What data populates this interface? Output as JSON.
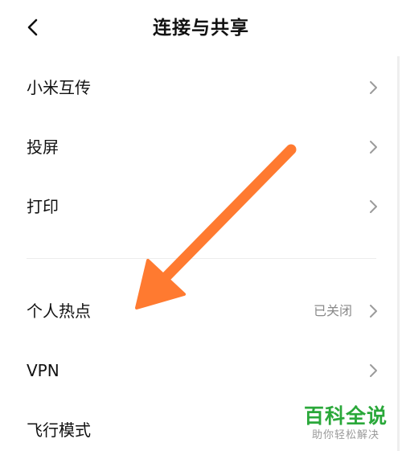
{
  "header": {
    "title": "连接与共享",
    "back_icon": "chevron-left-icon"
  },
  "group1": [
    {
      "label": "小米互传",
      "chevron_icon": "chevron-right-icon"
    },
    {
      "label": "投屏",
      "chevron_icon": "chevron-right-icon"
    },
    {
      "label": "打印",
      "chevron_icon": "chevron-right-icon"
    }
  ],
  "group2": [
    {
      "label": "个人热点",
      "status": "已关闭",
      "chevron_icon": "chevron-right-icon"
    },
    {
      "label": "VPN",
      "chevron_icon": "chevron-right-icon"
    },
    {
      "label": "飞行模式"
    }
  ],
  "watermark": {
    "main": "百科全说",
    "sub": "助你轻松解决",
    "color": "#2aa83a"
  },
  "annotation": {
    "arrow_color": "#ff7a30"
  }
}
